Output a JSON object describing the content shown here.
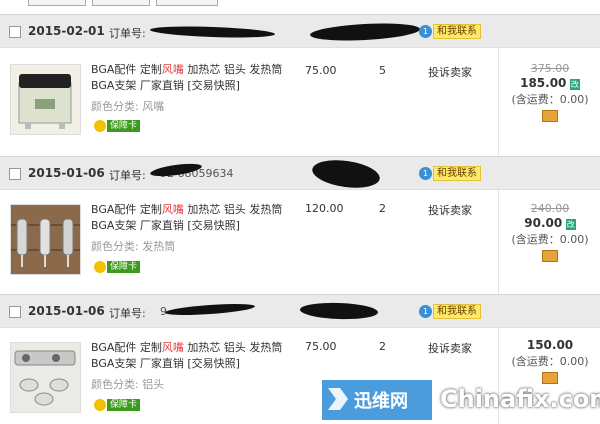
{
  "toolbar": {
    "buttons": [
      "",
      "",
      ""
    ]
  },
  "orders": [
    {
      "date": "2015-02-01",
      "order_label": "订单号:",
      "order_number_visible": "",
      "contact": "和我联系",
      "title_line1_a": "BGA配件 定制",
      "title_line1_red": "风嘴",
      "title_line1_b": " 加热芯 铝头 发热筒",
      "title_line2": "BGA支架 厂家直销 [交易快照]",
      "spec": "颜色分类: 风嘴",
      "guarantee": "保障卡",
      "unit_price": "75.00",
      "quantity": "5",
      "complain": "投诉卖家",
      "original_total": "375.00",
      "total": "185.00",
      "total_tag": "改",
      "shipping": "(含运费：0.00)"
    },
    {
      "date": "2015-01-06",
      "order_label": "订单号:",
      "order_number_visible": "92        68059634",
      "contact": "和我联系",
      "title_line1_a": "BGA配件 定制",
      "title_line1_red": "风嘴",
      "title_line1_b": " 加热芯 铝头 发热筒",
      "title_line2": "BGA支架 厂家直销 [交易快照]",
      "spec": "颜色分类: 发热筒",
      "guarantee": "保障卡",
      "unit_price": "120.00",
      "quantity": "2",
      "complain": "投诉卖家",
      "original_total": "240.00",
      "total": "90.00",
      "total_tag": "改",
      "shipping": "(含运费：0.00)"
    },
    {
      "date": "2015-01-06",
      "order_label": "订单号:",
      "order_number_visible": "9",
      "contact": "和我联系",
      "title_line1_a": "BGA配件 定制",
      "title_line1_red": "风嘴",
      "title_line1_b": " 加热芯 铝头 发热筒",
      "title_line2": "BGA支架 厂家直销 [交易快照]",
      "spec": "颜色分类: 铝头",
      "guarantee": "保障卡",
      "unit_price": "75.00",
      "quantity": "2",
      "complain": "投诉卖家",
      "original_total": "",
      "total": "150.00",
      "total_tag": "",
      "shipping": "(含运费：0.00)"
    }
  ],
  "watermark": {
    "cn": "迅维网",
    "en": "Chinafix.com"
  }
}
